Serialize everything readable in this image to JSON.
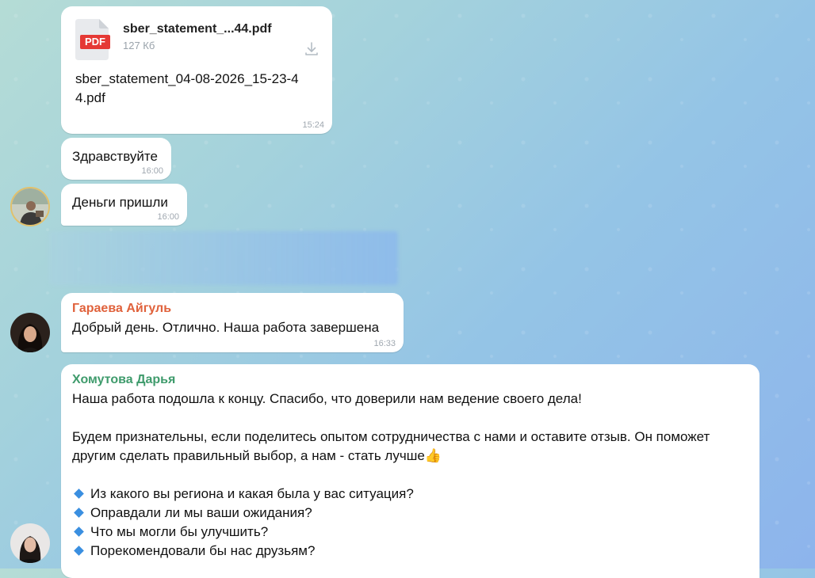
{
  "messages": {
    "file": {
      "name": "sber_statement_...44.pdf",
      "size": "127 Кб",
      "icon_label": "PDF",
      "caption": "sber_statement_04-08-2026_15-23-44.pdf",
      "time": "15:24"
    },
    "greeting": {
      "text": "Здравствуйте",
      "time": "16:00"
    },
    "money": {
      "text": "Деньги пришли",
      "time": "16:00"
    },
    "garaeva": {
      "sender": "Гараева Айгуль",
      "sender_color": "#e0623c",
      "text": "Добрый день. Отлично. Наша работа завершена",
      "time": "16:33"
    },
    "khomutova": {
      "sender": "Хомутова Дарья",
      "sender_color": "#3f9b6c",
      "line1": "Наша работа подошла к концу. Спасибо, что доверили нам ведение своего дела!",
      "line2": "Будем признательны, если поделитесь опытом сотрудничества с нами и оставите отзыв. Он поможет другим сделать правильный выбор, а нам - стать лучше",
      "emoji": "👍",
      "bullets": [
        "Из какого вы региона и какая была у вас ситуация?",
        "Оправдали ли мы ваши ожидания?",
        "Что мы могли бы улучшить?",
        "Порекомендовали бы нас друзьям?"
      ]
    }
  },
  "icons": {
    "download": "download-icon",
    "pdf": "pdf-file-icon",
    "bullet": "blue-diamond-icon"
  }
}
